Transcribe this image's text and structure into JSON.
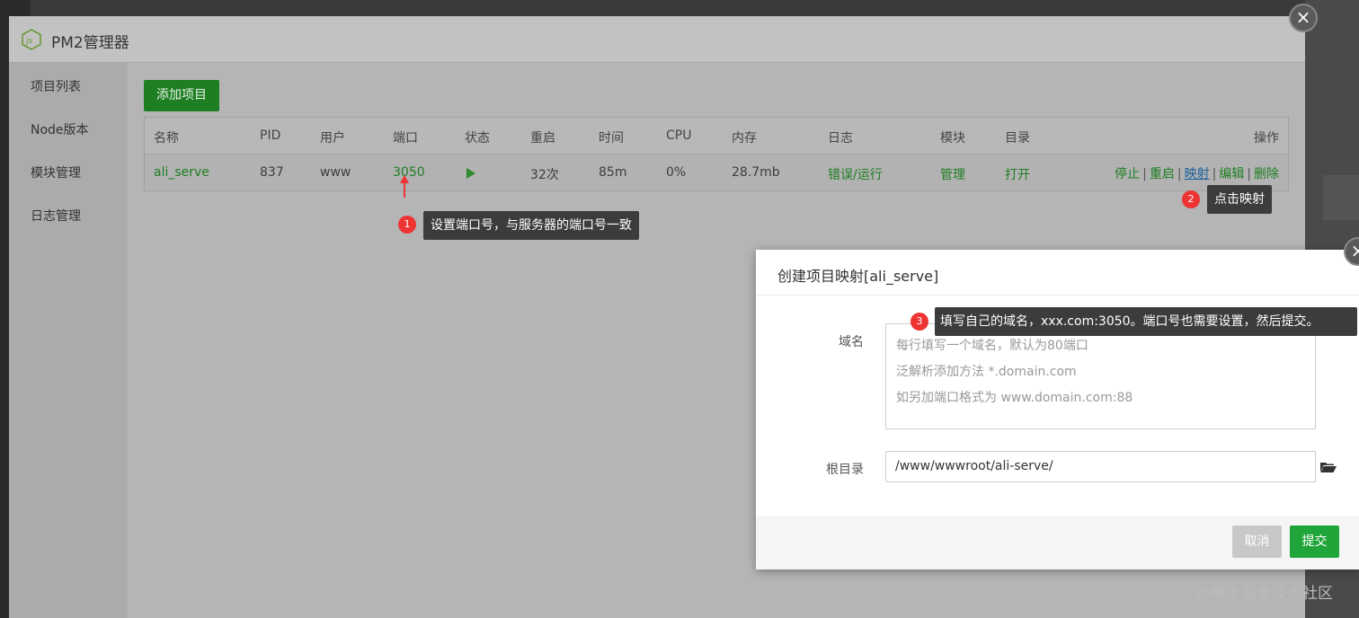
{
  "window": {
    "title": "PM2管理器",
    "close_icon": "×"
  },
  "sidebar": {
    "items": [
      {
        "label": "项目列表"
      },
      {
        "label": "Node版本"
      },
      {
        "label": "模块管理"
      },
      {
        "label": "日志管理"
      }
    ]
  },
  "toolbar": {
    "add_label": "添加项目"
  },
  "table": {
    "headers": [
      "名称",
      "PID",
      "用户",
      "端口",
      "状态",
      "重启",
      "时间",
      "CPU",
      "内存",
      "日志",
      "模块",
      "目录",
      "操作"
    ],
    "row": {
      "name": "ali_serve",
      "pid": "837",
      "user": "www",
      "port": "3050",
      "status_icon": "play-icon",
      "restarts": "32次",
      "time": "85m",
      "cpu": "0%",
      "memory": "28.7mb",
      "log": "错误/运行",
      "module": "管理",
      "dir": "打开",
      "ops": [
        "停止",
        "重启",
        "映射",
        "编辑",
        "删除"
      ]
    }
  },
  "annotations": [
    {
      "num": "1",
      "text": "设置端口号，与服务器的端口号一致"
    },
    {
      "num": "2",
      "text": "点击映射"
    },
    {
      "num": "3",
      "text": "填写自己的域名，xxx.com:3050。端口号也需要设置，然后提交。"
    }
  ],
  "dialog": {
    "title": "创建项目映射[ali_serve]",
    "domain_label": "域名",
    "domain_placeholder": [
      "每行填写一个域名，默认为80端口",
      "泛解析添加方法 *.domain.com",
      "如另加端口格式为 www.domain.com:88"
    ],
    "root_label": "根目录",
    "root_value": "/www/wwwroot/ali-serve/",
    "cancel_label": "取消",
    "submit_label": "提交",
    "close_icon": "×"
  },
  "watermark": "@稀土掘金技术社区",
  "colors": {
    "accent": "#20a53a",
    "annotation_red": "#e33333",
    "tooltip_bg": "#3c3c3c"
  }
}
